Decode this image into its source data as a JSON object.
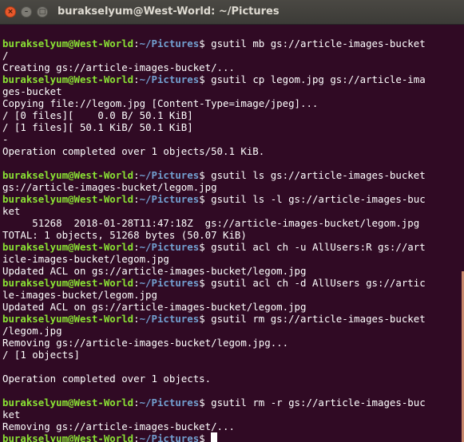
{
  "window": {
    "title": "burakselyum@West-World: ~/Pictures",
    "close_glyph": "×",
    "minimize_glyph": "–",
    "maximize_glyph": "□"
  },
  "terminal": {
    "prompt": {
      "user_host": "burakselyum@West-World",
      "colon": ":",
      "path": "~/Pictures",
      "symbol": "$ "
    },
    "lines": [
      {
        "type": "blank",
        "text": ""
      },
      {
        "type": "prompt",
        "cmd": "gsutil mb gs://article-images-bucket"
      },
      {
        "type": "output",
        "text": "/"
      },
      {
        "type": "output",
        "text": "Creating gs://article-images-bucket/..."
      },
      {
        "type": "prompt",
        "cmd": "gsutil cp legom.jpg gs://article-ima"
      },
      {
        "type": "output",
        "text": "ges-bucket"
      },
      {
        "type": "output",
        "text": "Copying file://legom.jpg [Content-Type=image/jpeg]..."
      },
      {
        "type": "output",
        "text": "/ [0 files][    0.0 B/ 50.1 KiB]"
      },
      {
        "type": "output",
        "text": "/ [1 files][ 50.1 KiB/ 50.1 KiB]"
      },
      {
        "type": "output",
        "text": "-"
      },
      {
        "type": "output",
        "text": "Operation completed over 1 objects/50.1 KiB."
      },
      {
        "type": "blank",
        "text": ""
      },
      {
        "type": "prompt",
        "cmd": "gsutil ls gs://article-images-bucket"
      },
      {
        "type": "output",
        "text": "gs://article-images-bucket/legom.jpg"
      },
      {
        "type": "prompt",
        "cmd": "gsutil ls -l gs://article-images-buc"
      },
      {
        "type": "output",
        "text": "ket"
      },
      {
        "type": "output",
        "text": "     51268  2018-01-28T11:47:18Z  gs://article-images-bucket/legom.jpg"
      },
      {
        "type": "output",
        "text": "TOTAL: 1 objects, 51268 bytes (50.07 KiB)"
      },
      {
        "type": "prompt",
        "cmd": "gsutil acl ch -u AllUsers:R gs://art"
      },
      {
        "type": "output",
        "text": "icle-images-bucket/legom.jpg"
      },
      {
        "type": "output",
        "text": "Updated ACL on gs://article-images-bucket/legom.jpg"
      },
      {
        "type": "prompt",
        "cmd": "gsutil acl ch -d AllUsers gs://artic"
      },
      {
        "type": "output",
        "text": "le-images-bucket/legom.jpg"
      },
      {
        "type": "output",
        "text": "Updated ACL on gs://article-images-bucket/legom.jpg"
      },
      {
        "type": "prompt",
        "cmd": "gsutil rm gs://article-images-bucket"
      },
      {
        "type": "output",
        "text": "/legom.jpg"
      },
      {
        "type": "output",
        "text": "Removing gs://article-images-bucket/legom.jpg..."
      },
      {
        "type": "output",
        "text": "/ [1 objects]"
      },
      {
        "type": "blank",
        "text": ""
      },
      {
        "type": "output",
        "text": "Operation completed over 1 objects."
      },
      {
        "type": "blank",
        "text": ""
      },
      {
        "type": "prompt",
        "cmd": "gsutil rm -r gs://article-images-buc"
      },
      {
        "type": "output",
        "text": "ket"
      },
      {
        "type": "output",
        "text": "Removing gs://article-images-bucket/..."
      },
      {
        "type": "prompt",
        "cmd": "",
        "cursor": true
      }
    ]
  },
  "colors": {
    "background": "#300a24",
    "prompt_user": "#8ae234",
    "prompt_path": "#729fcf",
    "text": "#ffffff",
    "close_button": "#e9582b"
  }
}
